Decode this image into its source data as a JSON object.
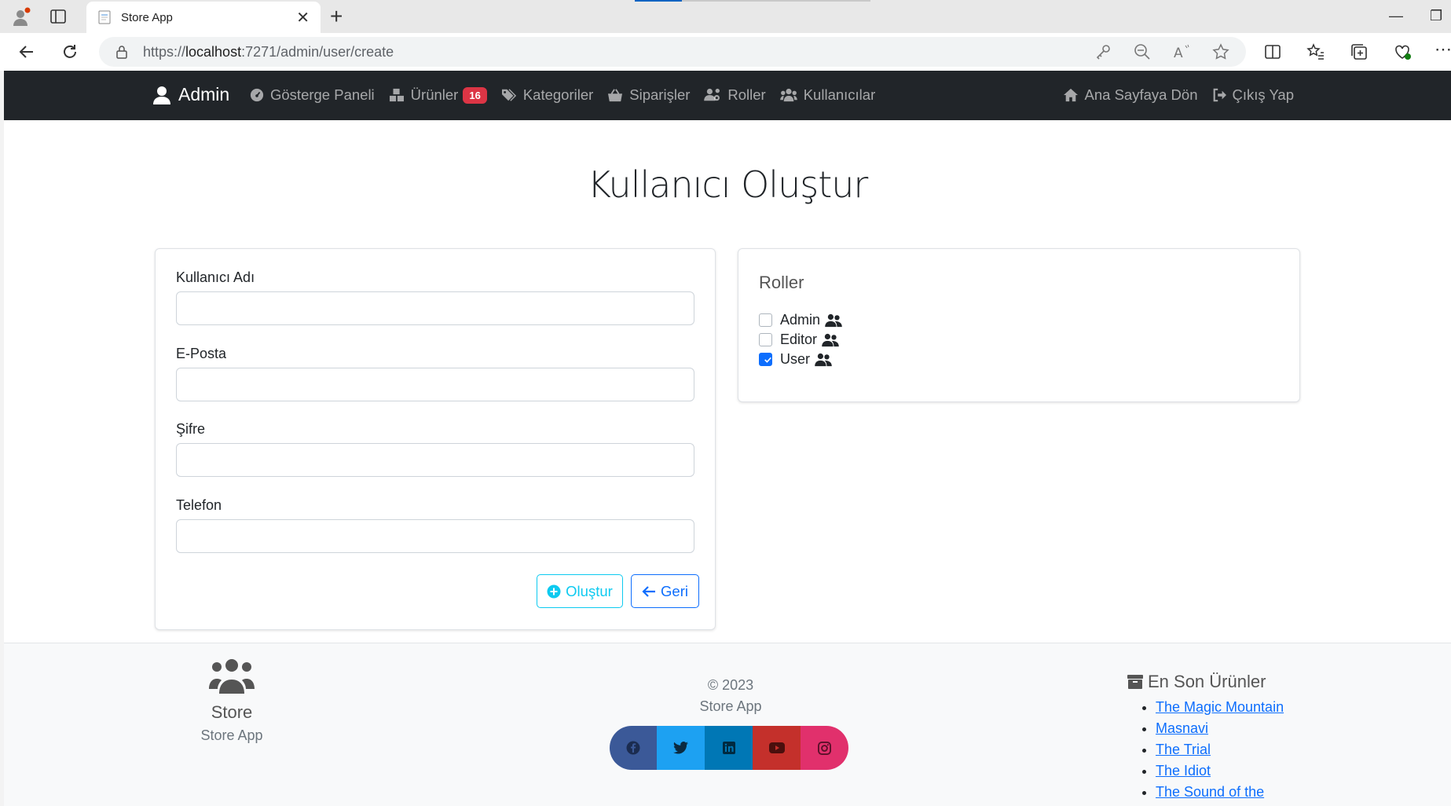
{
  "browser": {
    "tab_title": "Store App",
    "url_host": "localhost",
    "url_prefix": "https://",
    "url_suffix": ":7271/admin/user/create"
  },
  "navbar": {
    "brand": "Admin",
    "links": [
      {
        "label": "Gösterge Paneli",
        "icon": "dashboard-icon"
      },
      {
        "label": "Ürünler",
        "icon": "boxes-icon",
        "badge": "16"
      },
      {
        "label": "Kategoriler",
        "icon": "tags-icon"
      },
      {
        "label": "Siparişler",
        "icon": "basket-icon"
      },
      {
        "label": "Roller",
        "icon": "users-gear-icon"
      },
      {
        "label": "Kullanıcılar",
        "icon": "users-icon"
      }
    ],
    "right_links": [
      {
        "label": "Ana Sayfaya Dön",
        "icon": "home-icon"
      },
      {
        "label": "Çıkış Yap",
        "icon": "sign-out-icon"
      }
    ]
  },
  "page": {
    "title": "Kullanıcı Oluştur"
  },
  "form": {
    "fields": [
      {
        "label": "Kullanıcı Adı",
        "value": ""
      },
      {
        "label": "E-Posta",
        "value": ""
      },
      {
        "label": "Şifre",
        "value": ""
      },
      {
        "label": "Telefon",
        "value": ""
      }
    ],
    "create_label": "Oluştur",
    "back_label": "Geri"
  },
  "roles": {
    "title": "Roller",
    "items": [
      {
        "label": "Admin",
        "checked": false
      },
      {
        "label": "Editor",
        "checked": false
      },
      {
        "label": "User",
        "checked": true
      }
    ]
  },
  "footer": {
    "store_name": "Store",
    "store_sub": "Store App",
    "copyright": "© 2023",
    "app_name": "Store App",
    "socials": [
      {
        "name": "facebook-icon",
        "color": "#3b5998"
      },
      {
        "name": "twitter-icon",
        "color": "#1da1f2"
      },
      {
        "name": "linkedin-icon",
        "color": "#0077b5"
      },
      {
        "name": "youtube-icon",
        "color": "#c4302b"
      },
      {
        "name": "instagram-icon",
        "color": "#e1306c"
      }
    ],
    "latest_title": "En Son Ürünler",
    "latest_products": [
      "The Magic Mountain",
      "Masnavi",
      "The Trial",
      "The Idiot",
      "The Sound of the"
    ]
  }
}
